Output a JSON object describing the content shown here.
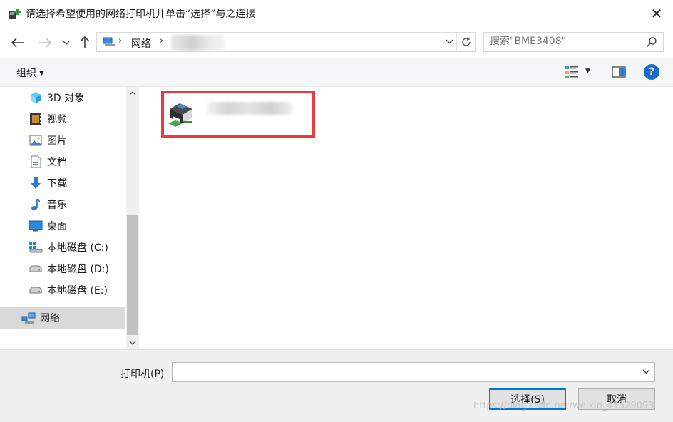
{
  "window": {
    "title": "请选择希望使用的网络打印机并单击“选择”与之连接",
    "close_label": "✕"
  },
  "nav": {
    "back_icon": "arrow-left-icon",
    "forward_icon": "arrow-right-icon",
    "recent_icon": "chevron-down-icon",
    "up_icon": "arrow-up-icon"
  },
  "address": {
    "crumbs": [
      "网络"
    ],
    "separator": "›"
  },
  "search": {
    "placeholder": "搜索\"BME3408\""
  },
  "toolbar": {
    "organize_label": "组织",
    "help_label": "?"
  },
  "sidebar": {
    "items": [
      {
        "label": "3D 对象",
        "icon": "3d-objects-icon"
      },
      {
        "label": "视频",
        "icon": "video-icon"
      },
      {
        "label": "图片",
        "icon": "pictures-icon"
      },
      {
        "label": "文档",
        "icon": "documents-icon"
      },
      {
        "label": "下载",
        "icon": "download-icon"
      },
      {
        "label": "音乐",
        "icon": "music-icon"
      },
      {
        "label": "桌面",
        "icon": "desktop-icon"
      },
      {
        "label": "本地磁盘 (C:)",
        "icon": "drive-c-icon"
      },
      {
        "label": "本地磁盘 (D:)",
        "icon": "drive-icon"
      },
      {
        "label": "本地磁盘 (E:)",
        "icon": "drive-icon"
      },
      {
        "label": "网络",
        "icon": "network-icon",
        "selected": true
      }
    ]
  },
  "content": {
    "items": [
      {
        "type": "network-printer",
        "icon": "network-printer-icon",
        "name_obscured": true
      }
    ]
  },
  "bottom": {
    "printer_label": "打印机(P)",
    "printer_value": "",
    "select_label": "选择(S)",
    "cancel_label": "取消"
  },
  "watermark": "https://blog.csdn.net/weixin_41529093",
  "colors": {
    "accent": "#0078d7",
    "highlight_border": "#f0383c",
    "help": "#1b6ac9",
    "selected_bg": "#d9d9d9"
  }
}
